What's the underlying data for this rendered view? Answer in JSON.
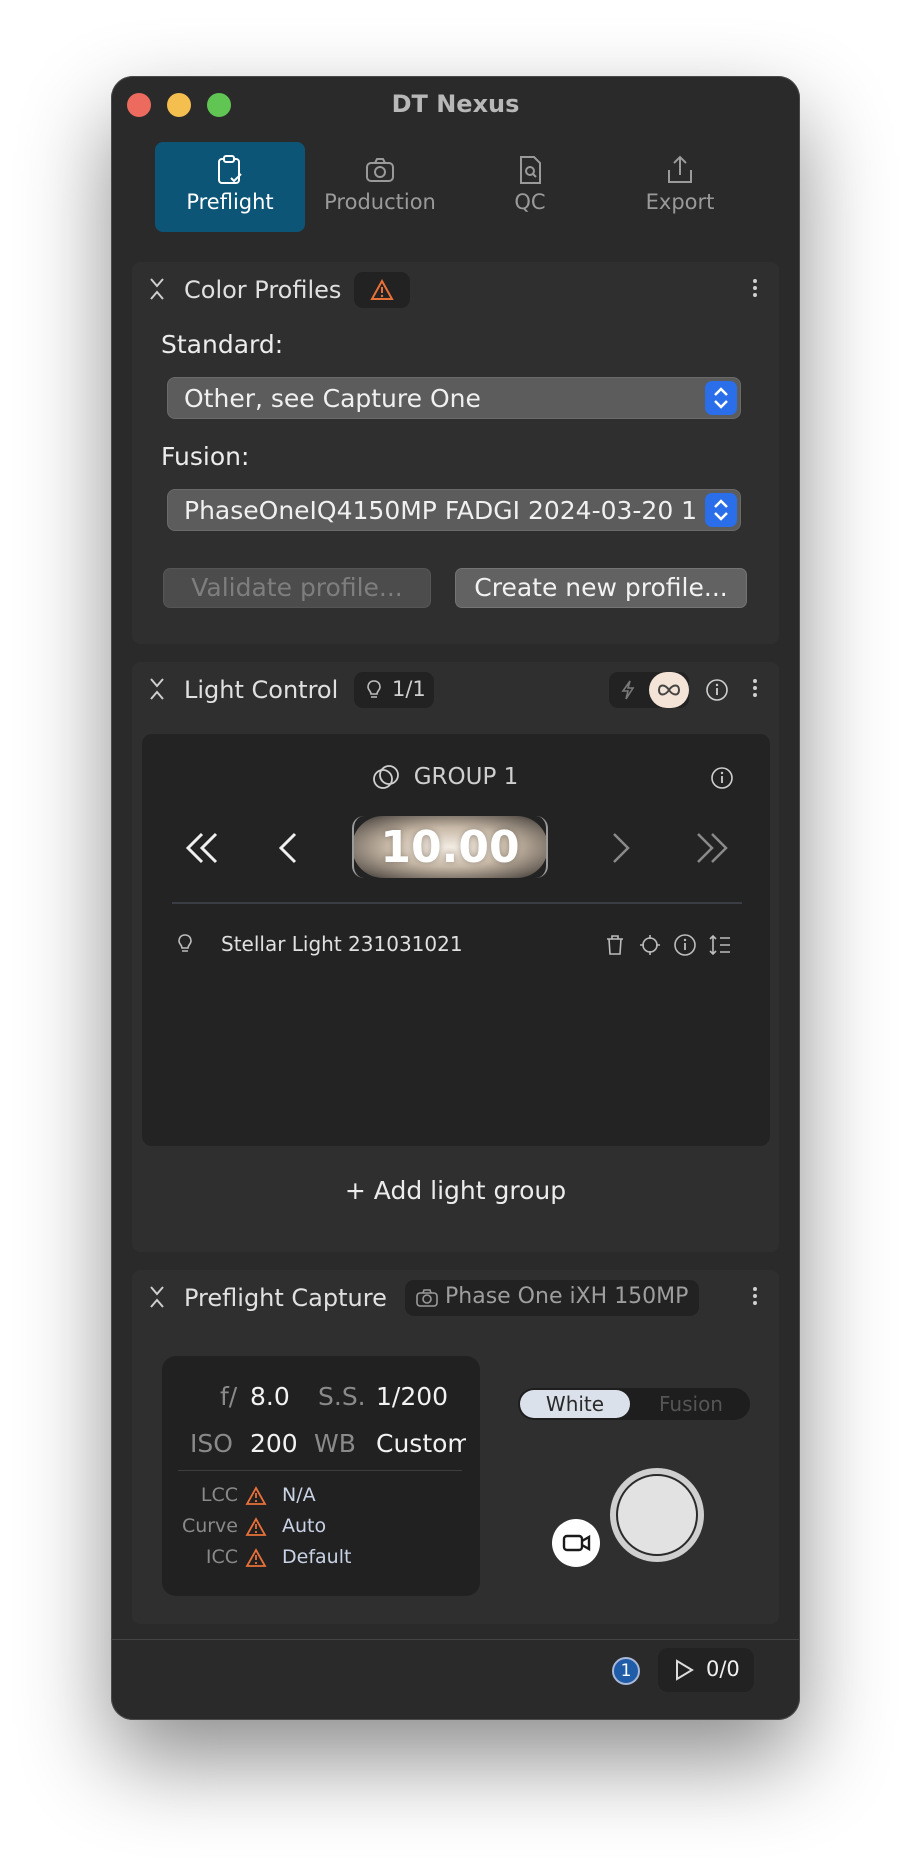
{
  "window": {
    "title": "DT Nexus"
  },
  "tabs": [
    {
      "label": "Preflight",
      "icon": "clipboard-check-icon",
      "active": true
    },
    {
      "label": "Production",
      "icon": "camera-icon",
      "active": false
    },
    {
      "label": "QC",
      "icon": "document-search-icon",
      "active": false
    },
    {
      "label": "Export",
      "icon": "share-icon",
      "active": false
    }
  ],
  "color_profiles": {
    "title": "Color Profiles",
    "standard_label": "Standard:",
    "standard_value": "Other, see Capture One",
    "fusion_label": "Fusion:",
    "fusion_value": "PhaseOneIQ4150MP FADGI 2024-03-20 1",
    "validate_button": "Validate profile...",
    "create_button": "Create new profile..."
  },
  "light_control": {
    "title": "Light Control",
    "light_count": "1/1",
    "group_title": "GROUP 1",
    "value": "10.00",
    "lights": [
      {
        "name": "Stellar Light 231031021"
      }
    ],
    "add_group": "+ Add light group"
  },
  "preflight_capture": {
    "title": "Preflight Capture",
    "camera": "Phase One iXH 150MP",
    "aperture_label": "f/",
    "aperture": "8.0",
    "shutter_label": "S.S.",
    "shutter": "1/200",
    "iso_label": "ISO",
    "iso": "200",
    "wb_label": "WB",
    "wb": "Custom",
    "lcc_label": "LCC",
    "lcc": "N/A",
    "curve_label": "Curve",
    "curve": "Auto",
    "icc_label": "ICC",
    "icc": "Default",
    "mode_white": "White",
    "mode_fusion": "Fusion"
  },
  "footer": {
    "notification_count": "1",
    "queue": "0/0"
  },
  "colors": {
    "accent": "#0d5577",
    "stepper": "#2a6ee9",
    "warning": "#e8703a"
  }
}
